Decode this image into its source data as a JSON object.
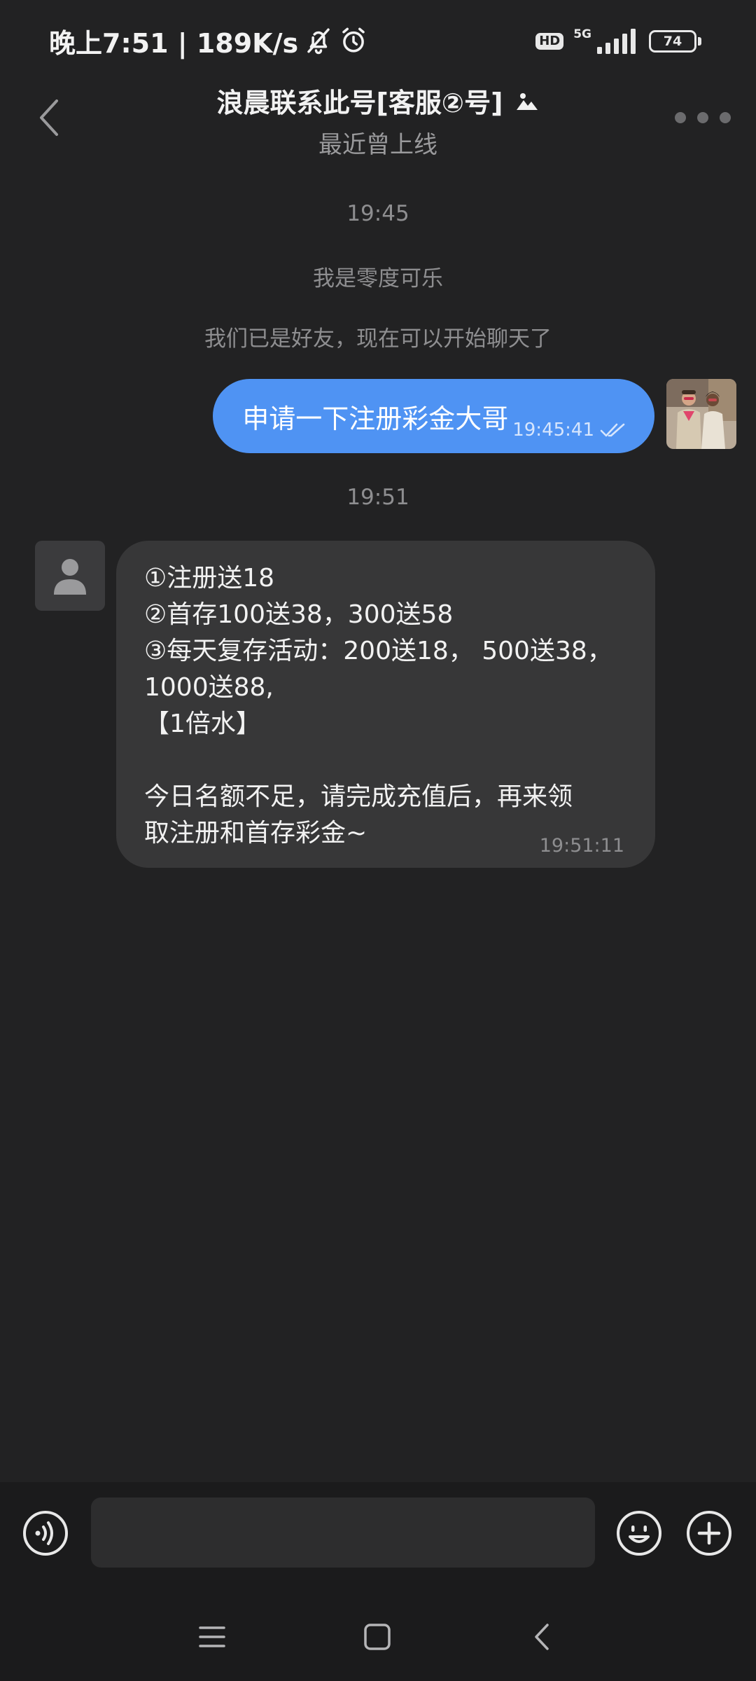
{
  "status_bar": {
    "time_speed": "晚上7:51 | 189K/s",
    "hd": "HD",
    "network": "5G",
    "battery": "74",
    "battery_level": 0.74
  },
  "header": {
    "title": "浪晨联系此号[客服②号]",
    "subtitle": "最近曾上线"
  },
  "chat": {
    "time_divider_1": "19:45",
    "system_msg_1": "我是零度可乐",
    "system_msg_2": "我们已是好友，现在可以开始聊天了",
    "outgoing": {
      "text": "申请一下注册彩金大哥",
      "time": "19:45:41"
    },
    "time_divider_2": "19:51",
    "incoming": {
      "lines": [
        "①注册送18",
        "②首存100送38，300送58",
        "③每天复存活动：200送18， 500送38，",
        "1000送88,",
        "【1倍水】",
        "",
        "今日名额不足，请完成充值后，再来领",
        "取注册和首存彩金~"
      ],
      "time": "19:51:11"
    }
  },
  "input_bar": {
    "placeholder": ""
  },
  "colors": {
    "background": "#222223",
    "outgoing_bubble": "#4f93f3",
    "incoming_bubble": "#373738",
    "input_bar": "#1b1b1c"
  },
  "icons": [
    "bell-off-icon",
    "alarm-icon",
    "signal-icon",
    "back-arrow-icon",
    "image-icon",
    "more-dots-icon",
    "double-check-icon",
    "person-icon",
    "voice-icon",
    "emoji-icon",
    "plus-icon",
    "menu-icon",
    "home-icon",
    "nav-back-icon"
  ]
}
